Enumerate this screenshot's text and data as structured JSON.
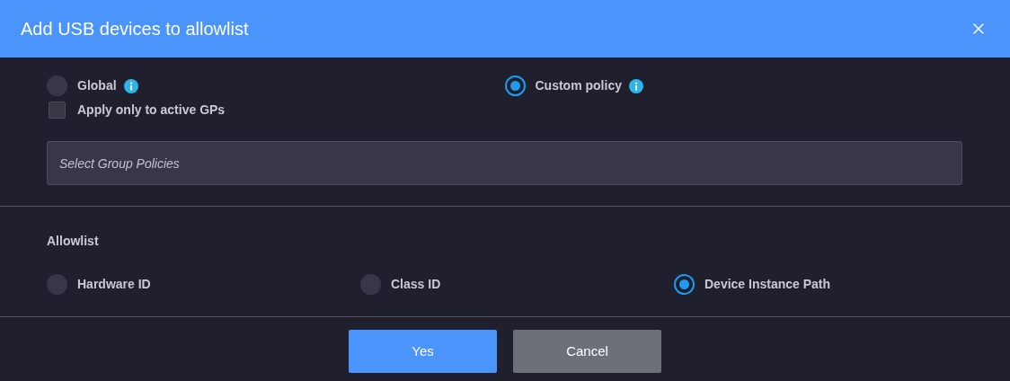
{
  "dialog": {
    "title": "Add USB devices to allowlist"
  },
  "scope": [
    {
      "label": "Global",
      "selected": false
    },
    {
      "label": "Custom policy",
      "selected": true
    }
  ],
  "active_only": {
    "label": "Apply only to active GPs",
    "checked": false
  },
  "group_policies": {
    "placeholder": "Select Group Policies"
  },
  "allowlist": {
    "heading": "Allowlist",
    "options": [
      {
        "label": "Hardware ID",
        "selected": false
      },
      {
        "label": "Class ID",
        "selected": false
      },
      {
        "label": "Device Instance Path",
        "selected": true
      }
    ]
  },
  "buttons": [
    {
      "label": "Yes",
      "kind": "primary"
    },
    {
      "label": "Cancel",
      "kind": "secondary"
    }
  ]
}
